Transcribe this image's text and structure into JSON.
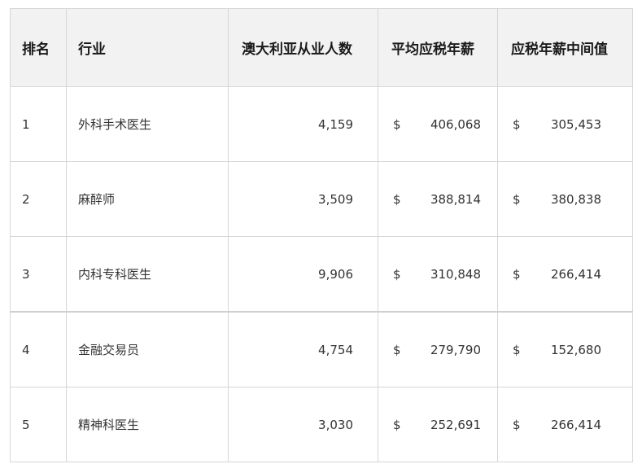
{
  "table": {
    "headers": {
      "rank": "排名",
      "industry": "行业",
      "count": "澳大利亚从业人数",
      "avg": "平均应税年薪",
      "median": "应税年薪中间值"
    },
    "currency_symbol": "$",
    "rows": [
      {
        "rank": "1",
        "industry": "外科手术医生",
        "count": "4,159",
        "avg": "406,068",
        "median": "305,453"
      },
      {
        "rank": "2",
        "industry": "麻醉师",
        "count": "3,509",
        "avg": "388,814",
        "median": "380,838"
      },
      {
        "rank": "3",
        "industry": "内科专科医生",
        "count": "9,906",
        "avg": "310,848",
        "median": "266,414"
      },
      {
        "rank": "4",
        "industry": "金融交易员",
        "count": "4,754",
        "avg": "279,790",
        "median": "152,680"
      },
      {
        "rank": "5",
        "industry": "精神科医生",
        "count": "3,030",
        "avg": "252,691",
        "median": "266,414"
      }
    ]
  }
}
